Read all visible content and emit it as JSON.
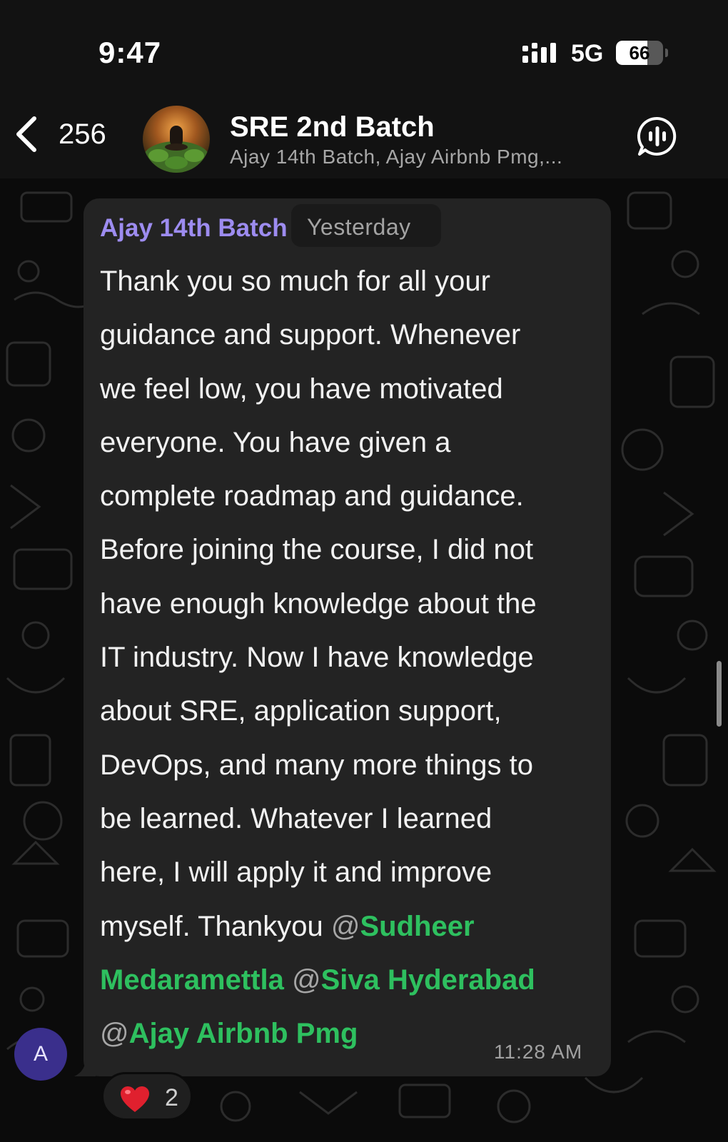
{
  "status_bar": {
    "time": "9:47",
    "network": "5G",
    "battery_percent": 66,
    "battery_label": "66"
  },
  "header": {
    "back_count": "256",
    "title": "SRE 2nd Batch",
    "members": "Ajay 14th Batch, Ajay Airbnb Pmg,..."
  },
  "message": {
    "sender": "Ajay 14th Batch",
    "sender_color": "#9d8cf0",
    "day_divider": "Yesterday",
    "lines": [
      "Thank you so much for all your",
      "guidance and support. Whenever",
      "we feel low, you have motivated",
      "everyone. You have given a",
      "complete roadmap and guidance.",
      "Before joining the course, I did not",
      "have enough knowledge about the",
      "IT industry. Now I have knowledge",
      "about SRE, application support,",
      "DevOps, and many more things to",
      "be learned. Whatever I learned",
      "here, I will apply it and improve"
    ],
    "last_line_prefix": "myself. Thankyou ",
    "mention_at": "@",
    "mentions": [
      "Sudheer",
      "Medaramettla",
      "Siva Hyderabad",
      "Ajay Airbnb Pmg"
    ],
    "mention_color": "#2ec05f",
    "time": "11:28 AM",
    "avatar_initial": "A"
  },
  "reaction": {
    "emoji": "heart",
    "count": "2"
  }
}
